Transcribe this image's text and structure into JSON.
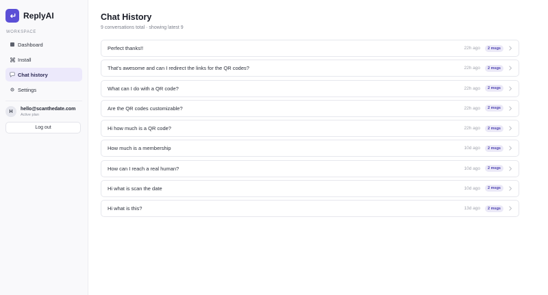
{
  "brand": {
    "name": "ReplyAI",
    "icon": "return-arrow-icon",
    "accent": "#5b4fd6"
  },
  "sidebar": {
    "section_label": "WORKSPACE",
    "items": [
      {
        "label": "Dashboard",
        "icon": "grid-icon",
        "active": false
      },
      {
        "label": "Install",
        "icon": "command-icon",
        "active": false
      },
      {
        "label": "Chat history",
        "icon": "chat-bubble-icon",
        "active": true
      },
      {
        "label": "Settings",
        "icon": "gear-icon",
        "active": false
      }
    ]
  },
  "user": {
    "initial": "H",
    "email": "hello@scanthedate.com",
    "plan": "Active plan",
    "logout_label": "Log out"
  },
  "main": {
    "title": "Chat History",
    "subtitle": "9 conversations total · showing latest 9",
    "chats": [
      {
        "title": "Perfect thanks!!",
        "time": "22h ago",
        "count": "2 msgs"
      },
      {
        "title": "That's awesome and can I redirect the links for the QR codes?",
        "time": "22h ago",
        "count": "2 msgs"
      },
      {
        "title": "What can I do with a QR code?",
        "time": "22h ago",
        "count": "2 msgs"
      },
      {
        "title": "Are the QR codes customizable?",
        "time": "22h ago",
        "count": "2 msgs"
      },
      {
        "title": "Hi how much is a QR code?",
        "time": "22h ago",
        "count": "2 msgs"
      },
      {
        "title": "How much is a membership",
        "time": "10d ago",
        "count": "2 msgs"
      },
      {
        "title": "How can I reach a real human?",
        "time": "10d ago",
        "count": "2 msgs"
      },
      {
        "title": "Hi what is scan the date",
        "time": "10d ago",
        "count": "2 msgs"
      },
      {
        "title": "Hi what is this?",
        "time": "13d ago",
        "count": "2 msgs"
      }
    ]
  }
}
